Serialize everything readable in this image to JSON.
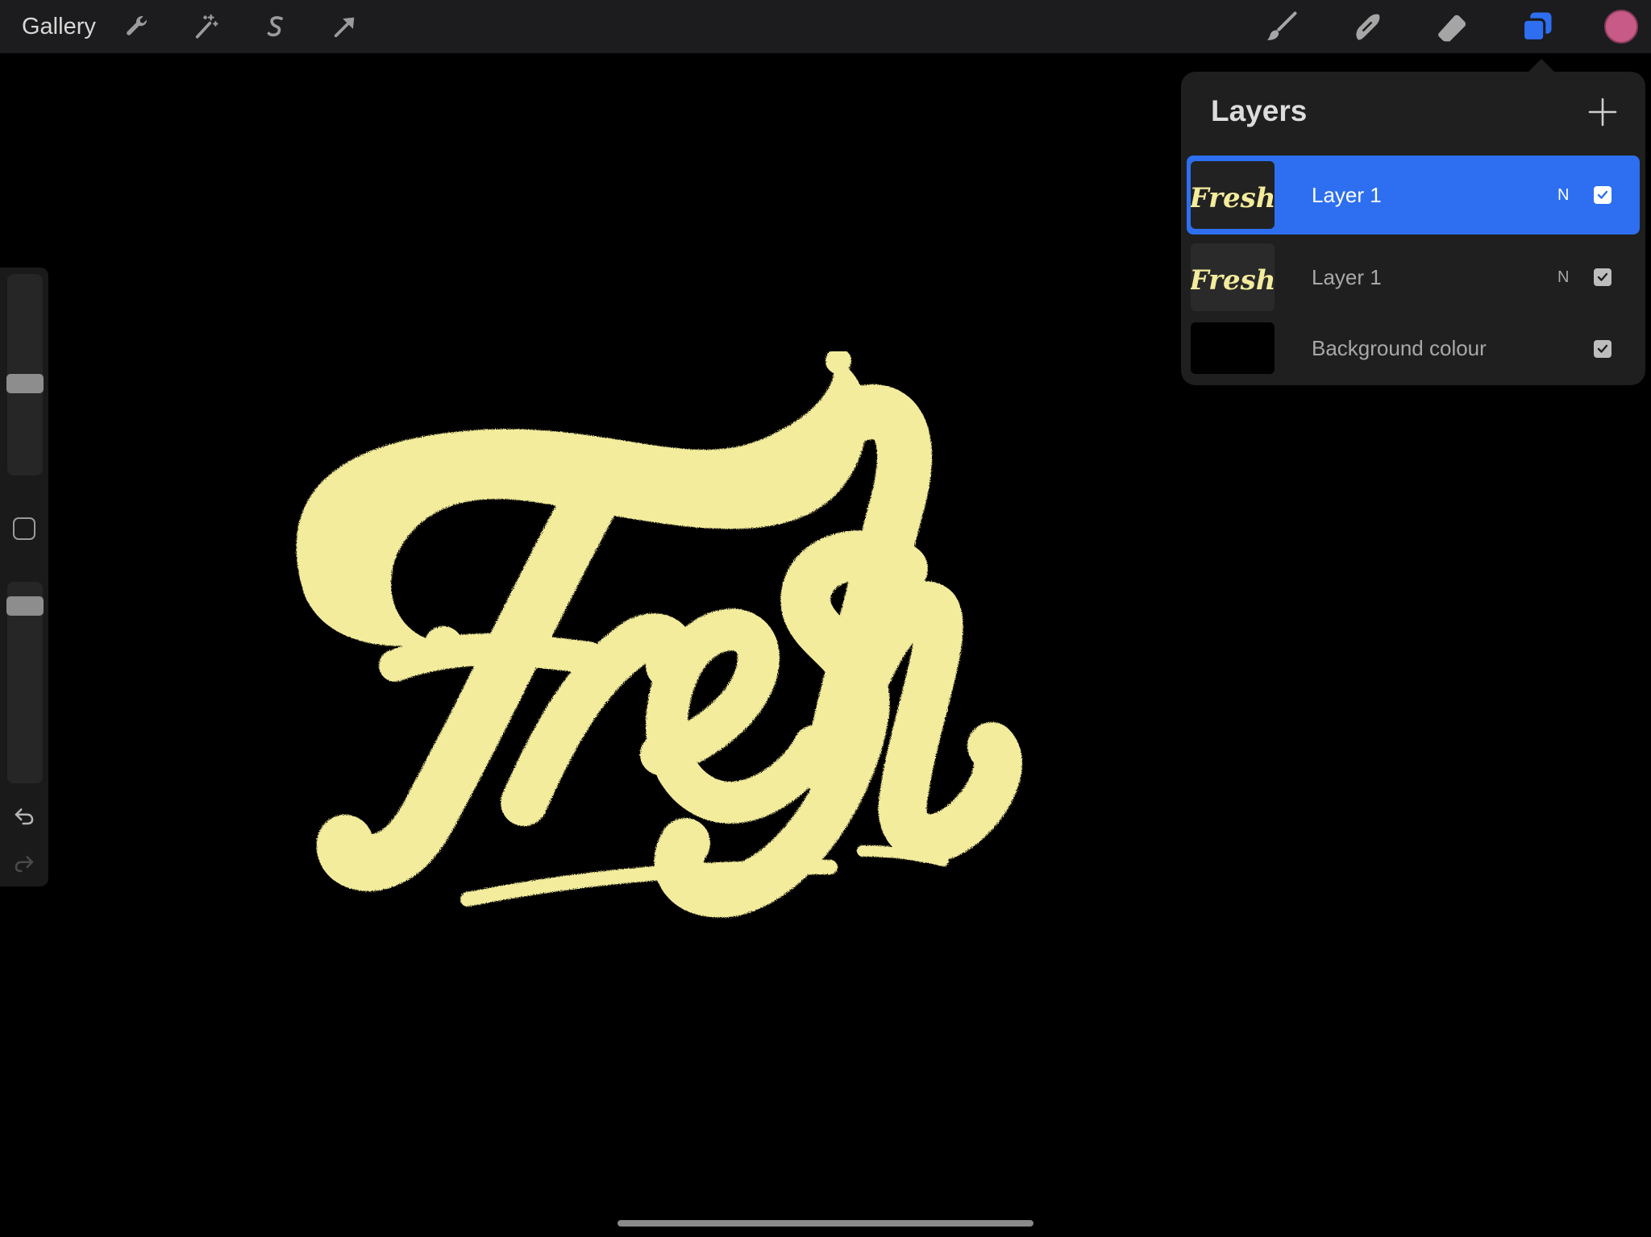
{
  "toolbar": {
    "gallery_label": "Gallery",
    "left_tools": [
      "wrench-icon",
      "magic-wand-icon",
      "selection-s-icon",
      "transform-arrow-icon"
    ],
    "right_tools": [
      "brush-icon",
      "smudge-icon",
      "eraser-icon",
      "layers-icon"
    ],
    "active_tool": "layers-icon",
    "active_color": "#c85a87",
    "accent_color": "#2d6ff0"
  },
  "canvas": {
    "background": "#000000",
    "artwork_text": "Fresh",
    "artwork_color": "#f3ec9c"
  },
  "sidebar": {
    "brush_size_level": 0.45,
    "opacity_level": 0.92,
    "icons": [
      "modify-square-icon",
      "undo-icon",
      "redo-icon"
    ]
  },
  "layers_panel": {
    "title": "Layers",
    "add_icon": "plus-icon",
    "layers": [
      {
        "name": "Layer 1",
        "blend_mode": "N",
        "visible": true,
        "selected": true,
        "thumb_text": "Fresh"
      },
      {
        "name": "Layer 1",
        "blend_mode": "N",
        "visible": true,
        "selected": false,
        "thumb_text": "Fresh"
      },
      {
        "name": "Background colour",
        "blend_mode": "",
        "visible": true,
        "selected": false
      }
    ]
  }
}
